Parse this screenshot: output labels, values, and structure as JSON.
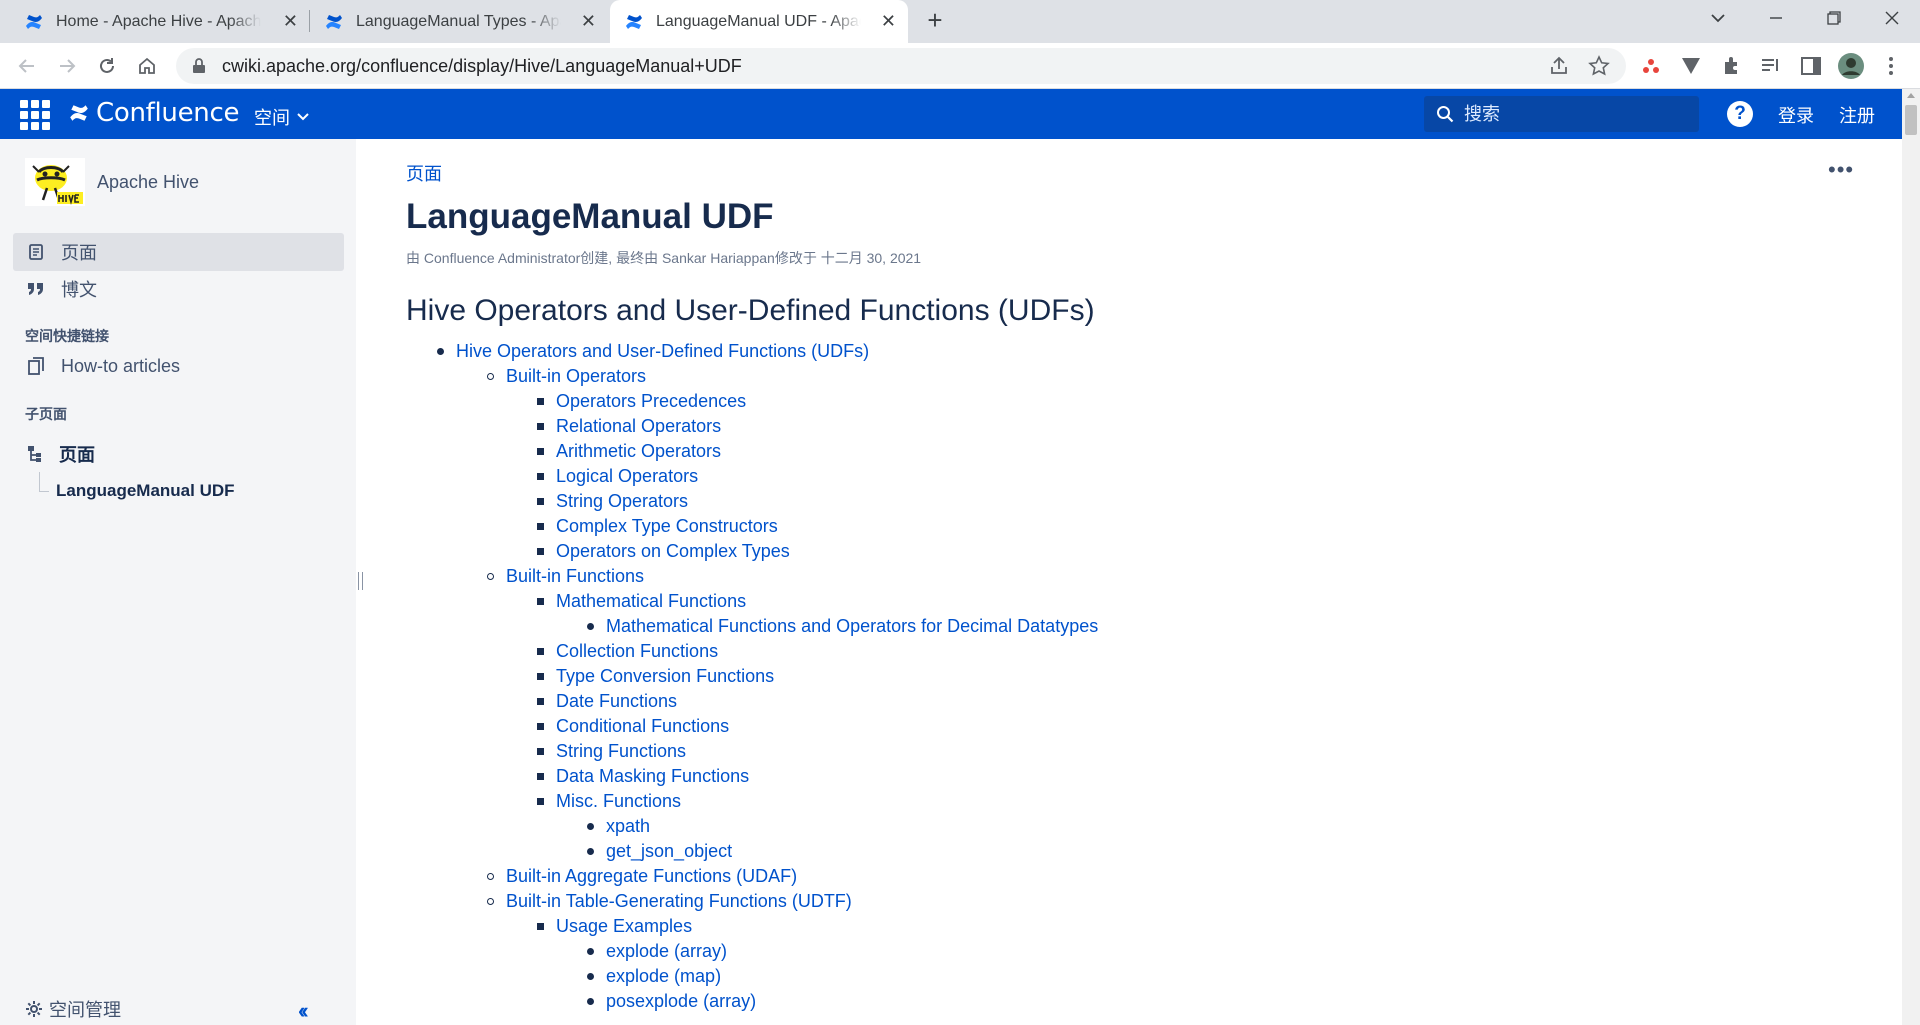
{
  "browser": {
    "tabs": [
      {
        "title": "Home - Apache Hive - Apache Software Foundation",
        "active": false
      },
      {
        "title": "LanguageManual Types - Apache Hive - Apache Software Foundation",
        "active": false
      },
      {
        "title": "LanguageManual UDF - Apache Hive - Apache Software Foundation",
        "active": true
      }
    ],
    "url": "cwiki.apache.org/confluence/display/Hive/LanguageManual+UDF",
    "colors": {
      "tab_bar": "#dee1e6",
      "omnibox": "#f1f3f4"
    }
  },
  "header": {
    "logo": "Confluence",
    "spaces_menu": "空间",
    "search_placeholder": "搜索",
    "help": "?",
    "login": "登录",
    "signup": "注册",
    "color": "#0052cc"
  },
  "sidebar": {
    "space_name": "Apache Hive",
    "nav": [
      {
        "label": "页面",
        "icon": "page-icon",
        "selected": true
      },
      {
        "label": "博文",
        "icon": "quote-icon",
        "selected": false
      }
    ],
    "shortcuts_heading": "空间快捷链接",
    "shortcuts": [
      {
        "label": "How-to articles",
        "icon": "copy-pages-icon"
      }
    ],
    "children_heading": "子页面",
    "tree_root": "页面",
    "tree_child": "LanguageManual UDF",
    "space_tools": "空间管理"
  },
  "content": {
    "breadcrumb": "页面",
    "more": "•••",
    "title": "LanguageManual UDF",
    "meta": "由 Confluence Administrator创建, 最终由 Sankar Hariappan修改于 十二月 30, 2021",
    "section_heading": "Hive Operators and User-Defined Functions (UDFs)",
    "toc": [
      {
        "text": "Hive Operators and User-Defined Functions (UDFs)",
        "level": 0
      },
      {
        "text": "Built-in Operators",
        "level": 1
      },
      {
        "text": "Operators Precedences",
        "level": 2
      },
      {
        "text": "Relational Operators",
        "level": 2
      },
      {
        "text": "Arithmetic Operators",
        "level": 2
      },
      {
        "text": "Logical Operators",
        "level": 2
      },
      {
        "text": "String Operators",
        "level": 2
      },
      {
        "text": "Complex Type Constructors",
        "level": 2
      },
      {
        "text": "Operators on Complex Types",
        "level": 2
      },
      {
        "text": "Built-in Functions",
        "level": 1
      },
      {
        "text": "Mathematical Functions",
        "level": 2
      },
      {
        "text": "Mathematical Functions and Operators for Decimal Datatypes",
        "level": 3
      },
      {
        "text": "Collection Functions",
        "level": 2
      },
      {
        "text": "Type Conversion Functions",
        "level": 2
      },
      {
        "text": "Date Functions",
        "level": 2
      },
      {
        "text": "Conditional Functions",
        "level": 2
      },
      {
        "text": "String Functions",
        "level": 2
      },
      {
        "text": "Data Masking Functions",
        "level": 2
      },
      {
        "text": "Misc. Functions",
        "level": 2
      },
      {
        "text": "xpath",
        "level": 3
      },
      {
        "text": "get_json_object",
        "level": 3
      },
      {
        "text": "Built-in Aggregate Functions (UDAF)",
        "level": 1
      },
      {
        "text": "Built-in Table-Generating Functions (UDTF)",
        "level": 1
      },
      {
        "text": "Usage Examples",
        "level": 2
      },
      {
        "text": "explode (array)",
        "level": 3
      },
      {
        "text": "explode (map)",
        "level": 3
      },
      {
        "text": "posexplode (array)",
        "level": 3
      }
    ]
  }
}
